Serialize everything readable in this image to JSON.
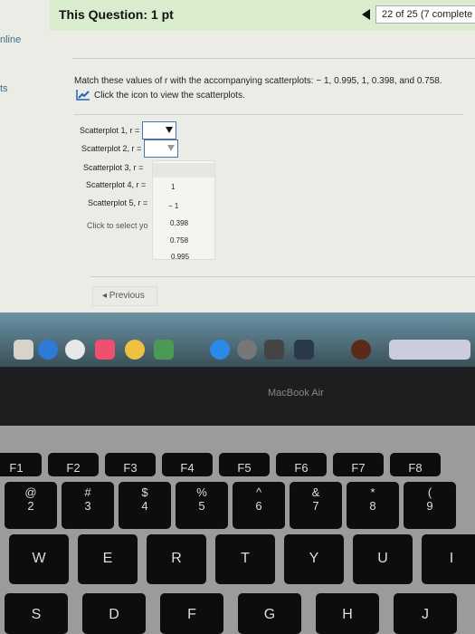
{
  "header": {
    "title": "This Question: 1 pt",
    "progress": "22 of 25 (7 complete"
  },
  "side": {
    "item1": "nline",
    "item2": "ts"
  },
  "question": {
    "prompt": "Match these values of r with the accompanying scatterplots: − 1, 0.995, 1, 0.398, and 0.758.",
    "hint": "Click the icon to view the scatterplots.",
    "rows": [
      "Scatterplot 1, r =",
      "Scatterplot 2, r =",
      "Scatterplot 3, r =",
      "Scatterplot 4, r =",
      "Scatterplot 5, r ="
    ],
    "footer": "Click to select yo",
    "options": [
      "1",
      "− 1",
      "0.398",
      "0.758",
      "0.995"
    ],
    "previous": "◂ Previous"
  },
  "laptop": {
    "brand": "MacBook Air"
  },
  "keyboard": {
    "fn": [
      "F1",
      "F2",
      "F3",
      "F4",
      "F5",
      "F6",
      "F7",
      "F8"
    ],
    "numbers": [
      [
        "@",
        "2"
      ],
      [
        "#",
        "3"
      ],
      [
        "$",
        "4"
      ],
      [
        "%",
        "5"
      ],
      [
        "^",
        "6"
      ],
      [
        "&",
        "7"
      ],
      [
        "*",
        "8"
      ],
      [
        "(",
        "9"
      ]
    ],
    "row2": [
      "W",
      "E",
      "R",
      "T",
      "Y",
      "U",
      "I"
    ],
    "row3": [
      "S",
      "D",
      "F",
      "G",
      "H",
      "J"
    ]
  }
}
